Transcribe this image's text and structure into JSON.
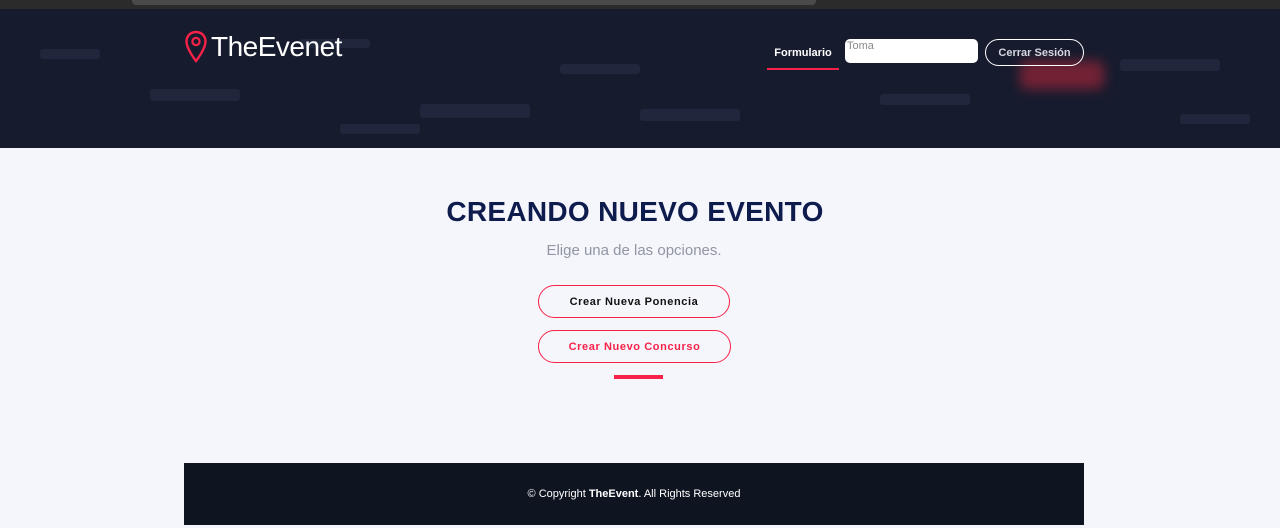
{
  "brand": {
    "name": "TheEvenet"
  },
  "nav": {
    "formulario_label": "Formulario",
    "search_placeholder": "Toma",
    "logout_label": "Cerrar Sesión"
  },
  "main": {
    "title": "CREANDO NUEVO EVENTO",
    "subtitle": "Elige una de las opciones.",
    "options": [
      {
        "label": "Crear Nueva Ponencia"
      },
      {
        "label": "Crear Nuevo Concurso"
      }
    ]
  },
  "footer": {
    "prefix": "© Copyright ",
    "brand": "TheEvent",
    "suffix": ". All Rights Reserved"
  },
  "colors": {
    "accent": "#f82249",
    "header_bg": "#161b2e",
    "title": "#0e1b4d",
    "footer_bg": "#0f1421"
  },
  "icons": {
    "logo": "map-pin-icon"
  }
}
